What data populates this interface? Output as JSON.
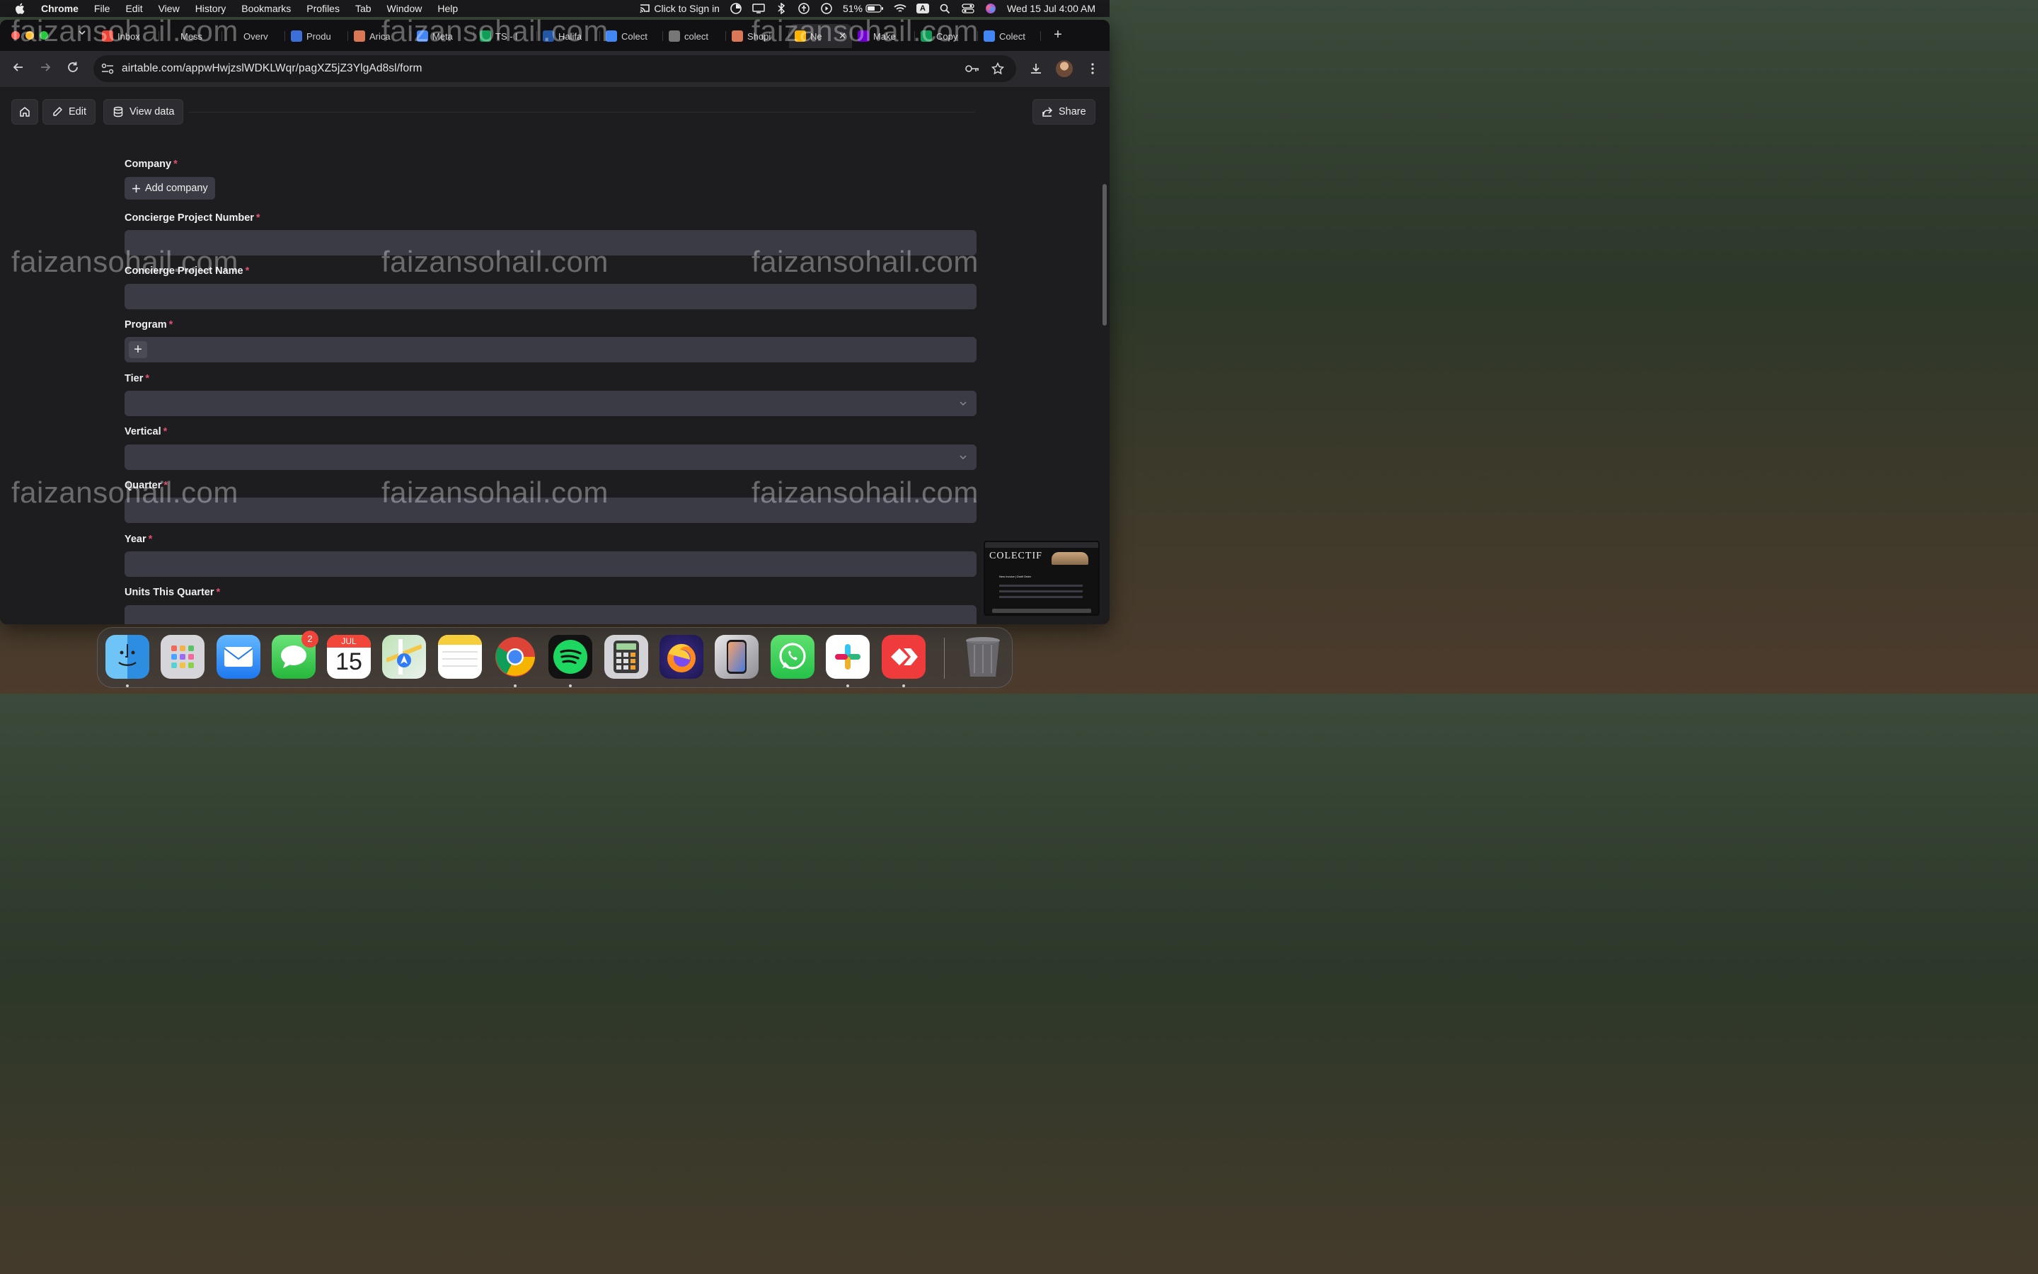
{
  "menubar": {
    "app_name": "Chrome",
    "items": [
      "File",
      "Edit",
      "View",
      "History",
      "Bookmarks",
      "Profiles",
      "Tab",
      "Window",
      "Help"
    ],
    "sign_in": "Click to Sign in",
    "battery": "51%",
    "input_source": "A",
    "datetime": "Wed 15 Jul  4:00 AM"
  },
  "tabs": [
    {
      "label": "Inbox",
      "icon": "gmail-icon",
      "color": "#ea4335"
    },
    {
      "label": "Mess",
      "icon": "upwork-icon",
      "color": "#111111"
    },
    {
      "label": "Overv",
      "icon": "upwork-icon",
      "color": "#111111"
    },
    {
      "label": "Produ",
      "icon": "cube-icon",
      "color": "#3d6fd8"
    },
    {
      "label": "Arica",
      "icon": "claude-icon",
      "color": "#d97757"
    },
    {
      "label": "Meta",
      "icon": "doc-icon",
      "color": "#4285f4"
    },
    {
      "label": "TS - I",
      "icon": "sheet-icon",
      "color": "#0f9d58"
    },
    {
      "label": "Halifa",
      "icon": "halifax-icon",
      "color": "#2456a6"
    },
    {
      "label": "Colect",
      "icon": "doc-icon",
      "color": "#4285f4"
    },
    {
      "label": "colect",
      "icon": "globe-icon",
      "color": "#777777"
    },
    {
      "label": "Shopi",
      "icon": "claude-icon",
      "color": "#d97757"
    },
    {
      "label": "Ne",
      "icon": "airtable-icon",
      "color": "#fcb400",
      "active": true
    },
    {
      "label": "Make",
      "icon": "make-icon",
      "color": "#6d00cc"
    },
    {
      "label": "Copy",
      "icon": "sheet-icon",
      "color": "#0f9d58"
    },
    {
      "label": "Colect",
      "icon": "doc-icon",
      "color": "#4285f4"
    }
  ],
  "address_bar": {
    "url": "airtable.com/appwHwjzslWDKLWqr/pagXZ5jZ3YlgAd8sl/form"
  },
  "page_toolbar": {
    "edit_label": "Edit",
    "view_data_label": "View data",
    "share_label": "Share"
  },
  "form": {
    "required_mark": "*",
    "company": {
      "label": "Company",
      "button": "Add company"
    },
    "project_number": {
      "label": "Concierge Project Number",
      "value": ""
    },
    "project_name": {
      "label": "Concierge Project Name",
      "value": ""
    },
    "program": {
      "label": "Program"
    },
    "tier": {
      "label": "Tier",
      "value": ""
    },
    "vertical": {
      "label": "Vertical",
      "value": ""
    },
    "quarter": {
      "label": "Quarter",
      "value": ""
    },
    "year": {
      "label": "Year",
      "value": ""
    },
    "units": {
      "label": "Units This Quarter",
      "value": ""
    }
  },
  "thumbnail": {
    "brand": "COLECTIF",
    "title": "New Invoice | Draft Order"
  },
  "watermark": "faizansohail.com",
  "dock": {
    "calendar_month": "JUL",
    "calendar_day": "15",
    "messages_badge": "2"
  },
  "colors": {
    "accent_required": "#e0506c",
    "field_bg": "#3a3b44",
    "page_bg": "#1d1d20"
  }
}
